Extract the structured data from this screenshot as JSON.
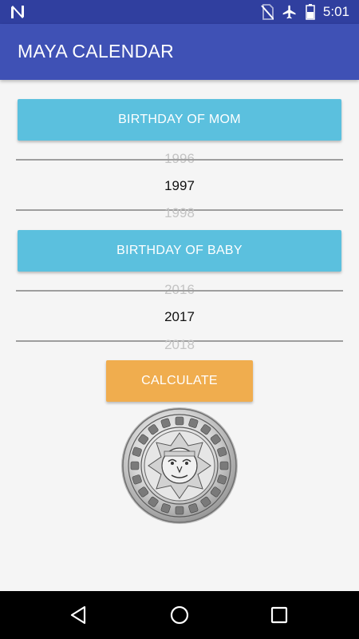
{
  "status_bar": {
    "time": "5:01",
    "icons": [
      "n-notification-icon",
      "no-sim-icon",
      "airplane-mode-icon",
      "battery-icon"
    ]
  },
  "app_bar": {
    "title": "MAYA CALENDAR"
  },
  "mom": {
    "button_label": "BIRTHDAY OF MOM",
    "picker": {
      "prev": "1996",
      "selected": "1997",
      "next": "1998"
    }
  },
  "baby": {
    "button_label": "BIRTHDAY OF BABY",
    "picker": {
      "prev": "2016",
      "selected": "2017",
      "next": "2018"
    }
  },
  "calculate_label": "CALCULATE",
  "colors": {
    "status_bar": "#303f9f",
    "app_bar": "#3f51b5",
    "birthday_button": "#5bc0de",
    "calculate_button": "#f0ad4e",
    "background": "#f5f5f5"
  },
  "nav_bar": {
    "icons": [
      "back-icon",
      "home-icon",
      "recents-icon"
    ]
  }
}
